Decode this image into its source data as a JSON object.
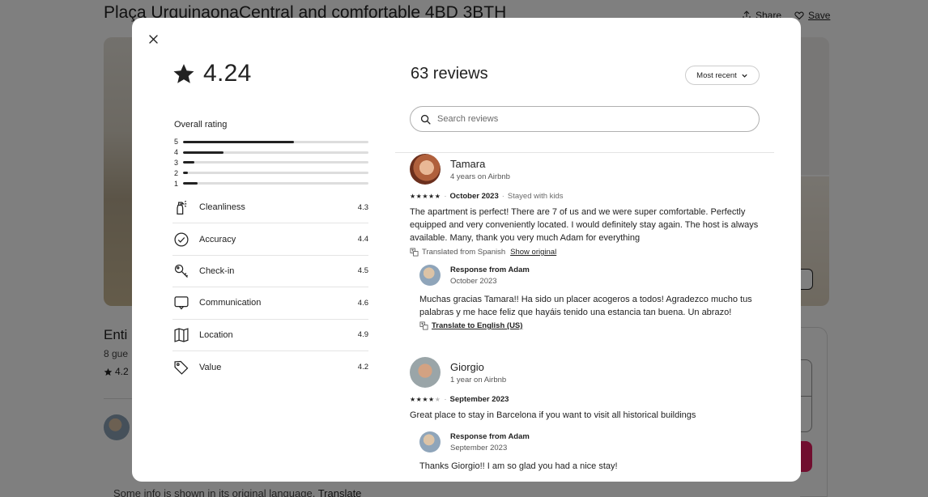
{
  "listing": {
    "title": "Plaça UrquinaonaCentral and comfortable 4BD 3BTH",
    "share_label": "Share",
    "save_label": "Save",
    "type_text": "Enti",
    "guests_text": "8 gue",
    "rating_text": "4.2",
    "info_text": "Some info is shown in its original language.",
    "info_link": "Translate"
  },
  "modal": {
    "rating": "4.24",
    "overall_label": "Overall rating",
    "distribution": [
      {
        "star": "5",
        "fraction": 0.6
      },
      {
        "star": "4",
        "fraction": 0.22
      },
      {
        "star": "3",
        "fraction": 0.06
      },
      {
        "star": "2",
        "fraction": 0.025
      },
      {
        "star": "1",
        "fraction": 0.08
      }
    ],
    "categories": [
      {
        "name": "Cleanliness",
        "value": "4.3",
        "icon": "spray-bottle-icon"
      },
      {
        "name": "Accuracy",
        "value": "4.4",
        "icon": "check-circle-icon"
      },
      {
        "name": "Check-in",
        "value": "4.5",
        "icon": "key-icon"
      },
      {
        "name": "Communication",
        "value": "4.6",
        "icon": "message-icon"
      },
      {
        "name": "Location",
        "value": "4.9",
        "icon": "map-icon"
      },
      {
        "name": "Value",
        "value": "4.2",
        "icon": "tag-icon"
      }
    ],
    "reviews_heading": "63 reviews",
    "sort_label": "Most recent",
    "search_placeholder": "Search reviews",
    "reviews": [
      {
        "name": "Tamara",
        "tenure": "4 years on Airbnb",
        "stars": 5,
        "date": "October 2023",
        "stay": "Stayed with kids",
        "text": "The apartment is perfect! There are 7 of us and we were super comfortable. Perfectly equipped and very conveniently located. I would definitely stay again. The host is always available. Many, thank you very much Adam for everything",
        "translated_note": "Translated from Spanish",
        "translated_link": "Show original",
        "response": {
          "from": "Response from Adam",
          "date": "October 2023",
          "text": "Muchas gracias Tamara!! Ha sido un placer acogeros a todos! Agradezco mucho tus palabras y me hace feliz que hayáis tenido una estancia tan buena. Un abrazo!",
          "translate_link": "Translate to English (US)"
        }
      },
      {
        "name": "Giorgio",
        "tenure": "1 year on Airbnb",
        "stars": 4,
        "date": "September 2023",
        "text": "Great place to stay in Barcelona if you want to visit all historical buildings",
        "response": {
          "from": "Response from Adam",
          "date": "September 2023",
          "text": "Thanks Giorgio!! I am so glad you had a nice stay!"
        }
      }
    ]
  }
}
